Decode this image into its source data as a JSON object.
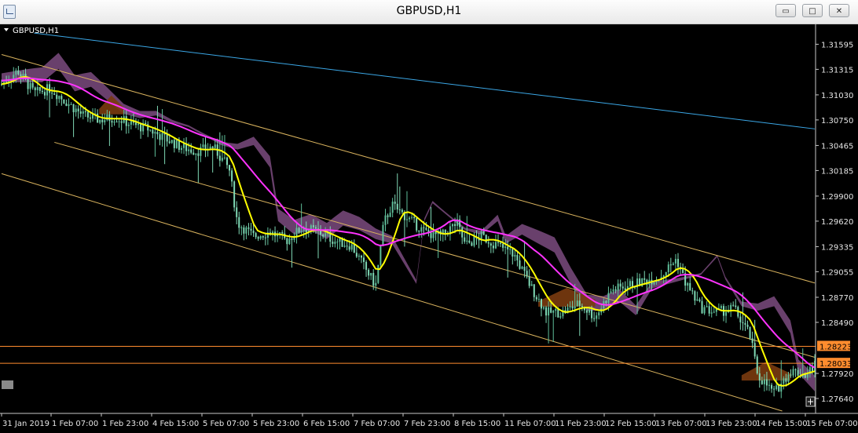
{
  "window": {
    "title": "GBPUSD,H1",
    "buttons": {
      "minimize": "▭",
      "maximize": "□",
      "close": "✕"
    }
  },
  "chart": {
    "label": "GBPUSD,H1",
    "colors": {
      "background": "#000000",
      "bull_candle": "#5fbf9a",
      "bear_candle": "#7fd9b5",
      "ma_fast": "#ffff00",
      "ma_slow": "#ff33ff",
      "kumo_bear": "#7b4b7f",
      "kumo_bull": "#7a3b10",
      "channel": "#d9b35e",
      "trend_blue": "#3ba7e6",
      "hline": "#ff8c2e",
      "price_tag": "#ff8c2e"
    }
  },
  "chart_data": {
    "type": "candlestick",
    "symbol": "GBPUSD",
    "timeframe": "H1",
    "ylim": [
      1.275,
      1.318
    ],
    "y_ticks": [
      "1.31595",
      "1.31315",
      "1.31030",
      "1.30750",
      "1.30465",
      "1.30185",
      "1.29900",
      "1.29620",
      "1.29335",
      "1.29055",
      "1.28770",
      "1.28490",
      "1.27920",
      "1.27640"
    ],
    "x_ticks": [
      "31 Jan 2019",
      "1 Feb 07:00",
      "1 Feb 23:00",
      "4 Feb 15:00",
      "5 Feb 07:00",
      "5 Feb 23:00",
      "6 Feb 15:00",
      "7 Feb 07:00",
      "7 Feb 23:00",
      "8 Feb 15:00",
      "11 Feb 07:00",
      "11 Feb 23:00",
      "12 Feb 15:00",
      "13 Feb 07:00",
      "13 Feb 23:00",
      "14 Feb 15:00",
      "15 Feb 07:00"
    ],
    "price_tags": [
      "1.28223",
      "1.28033"
    ],
    "hlines": [
      1.28223,
      1.28033
    ],
    "close_path": [
      [
        0,
        1.3115
      ],
      [
        0.02,
        1.313
      ],
      [
        0.04,
        1.3105
      ],
      [
        0.06,
        1.311
      ],
      [
        0.08,
        1.3095
      ],
      [
        0.1,
        1.308
      ],
      [
        0.12,
        1.3075
      ],
      [
        0.14,
        1.3078
      ],
      [
        0.16,
        1.307
      ],
      [
        0.18,
        1.3065
      ],
      [
        0.2,
        1.3055
      ],
      [
        0.22,
        1.3045
      ],
      [
        0.24,
        1.304
      ],
      [
        0.26,
        1.3045
      ],
      [
        0.28,
        1.302
      ],
      [
        0.29,
        1.296
      ],
      [
        0.31,
        1.2945
      ],
      [
        0.33,
        1.295
      ],
      [
        0.35,
        1.294
      ],
      [
        0.37,
        1.2955
      ],
      [
        0.39,
        1.295
      ],
      [
        0.41,
        1.294
      ],
      [
        0.43,
        1.2935
      ],
      [
        0.45,
        1.2905
      ],
      [
        0.46,
        1.289
      ],
      [
        0.47,
        1.296
      ],
      [
        0.48,
        1.298
      ],
      [
        0.5,
        1.2965
      ],
      [
        0.52,
        1.295
      ],
      [
        0.54,
        1.2945
      ],
      [
        0.56,
        1.296
      ],
      [
        0.57,
        1.2935
      ],
      [
        0.59,
        1.2945
      ],
      [
        0.61,
        1.2935
      ],
      [
        0.63,
        1.2925
      ],
      [
        0.65,
        1.289
      ],
      [
        0.67,
        1.286
      ],
      [
        0.69,
        1.286
      ],
      [
        0.71,
        1.287
      ],
      [
        0.73,
        1.2855
      ],
      [
        0.75,
        1.2885
      ],
      [
        0.77,
        1.289
      ],
      [
        0.79,
        1.2895
      ],
      [
        0.81,
        1.29
      ],
      [
        0.83,
        1.292
      ],
      [
        0.84,
        1.2895
      ],
      [
        0.86,
        1.2865
      ],
      [
        0.88,
        1.286
      ],
      [
        0.9,
        1.2865
      ],
      [
        0.92,
        1.2835
      ],
      [
        0.93,
        1.279
      ],
      [
        0.95,
        1.277
      ],
      [
        0.97,
        1.2795
      ],
      [
        0.99,
        1.279
      ],
      [
        1.0,
        1.2803
      ]
    ]
  }
}
